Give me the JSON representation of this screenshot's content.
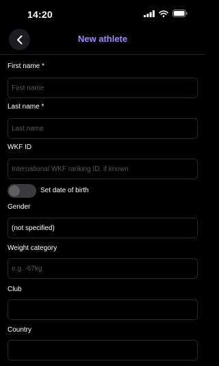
{
  "status_bar": {
    "time": "14:20",
    "icons": [
      "cellular-icon",
      "wifi-icon",
      "battery-icon"
    ]
  },
  "nav": {
    "title": "New athlete",
    "back_icon": "chevron-left-icon"
  },
  "form": {
    "first_name": {
      "label": "First name *",
      "placeholder": "First name",
      "value": ""
    },
    "last_name": {
      "label": "Last name *",
      "placeholder": "Last name",
      "value": ""
    },
    "wkf_id": {
      "label": "WKF ID",
      "placeholder": "International WKF ranking ID, if known",
      "value": ""
    },
    "dob_toggle": {
      "label": "Set date of birth",
      "checked": false
    },
    "gender": {
      "label": "Gender",
      "value": "(not specified)"
    },
    "weight": {
      "label": "Weight category",
      "placeholder": "e.g. -67kg",
      "value": ""
    },
    "club": {
      "label": "Club",
      "placeholder": "",
      "value": ""
    },
    "country": {
      "label": "Country",
      "placeholder": "",
      "value": ""
    }
  },
  "colors": {
    "accent": "#9b8cff",
    "background": "#000000",
    "field_border": "#26262b",
    "placeholder": "#56565c"
  }
}
